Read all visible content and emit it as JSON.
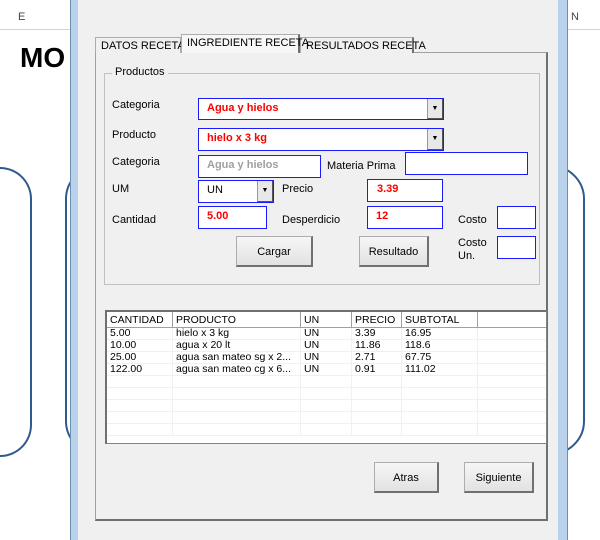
{
  "background": {
    "col_e": "E",
    "col_n": "N",
    "title_fragment": "MO"
  },
  "tabs": [
    {
      "label": "DATOS RECETA"
    },
    {
      "label": "INGREDIENTE RECETA"
    },
    {
      "label": "RESULTADOS RECETA"
    }
  ],
  "productos": {
    "legend": "Productos",
    "categoria_label": "Categoria",
    "categoria_value": "Agua y hielos",
    "producto_label": "Producto",
    "producto_value": "hielo x 3 kg",
    "categoria2_label": "Categoria",
    "categoria2_value": "Agua y hielos",
    "materia_prima_label": "Materia Prima",
    "materia_prima_value": "",
    "um_label": "UM",
    "um_value": "UN",
    "precio_label": "Precio",
    "precio_value": "3.39",
    "cantidad_label": "Cantidad",
    "cantidad_value": "5.00",
    "desperdicio_label": "Desperdicio",
    "desperdicio_value": "12",
    "costo_label": "Costo",
    "costo_value": "",
    "costo_un_label": "Costo Un.",
    "costo_un_value": "",
    "cargar": "Cargar",
    "resultado": "Resultado"
  },
  "table": {
    "headers": [
      "CANTIDAD",
      "PRODUCTO",
      "UN",
      "PRECIO",
      "SUBTOTAL",
      ""
    ],
    "rows": [
      [
        "5.00",
        "hielo x 3 kg",
        "UN",
        "3.39",
        "16.95"
      ],
      [
        "10.00",
        "agua x 20 lt",
        "UN",
        "11.86",
        "118.6"
      ],
      [
        "25.00",
        "agua san mateo sg x 2...",
        "UN",
        "2.71",
        "67.75"
      ],
      [
        "122.00",
        "agua san mateo cg x 6...",
        "UN",
        "0.91",
        "111.02"
      ]
    ]
  },
  "buttons": {
    "atras": "Atras",
    "siguiente": "Siguiente"
  }
}
